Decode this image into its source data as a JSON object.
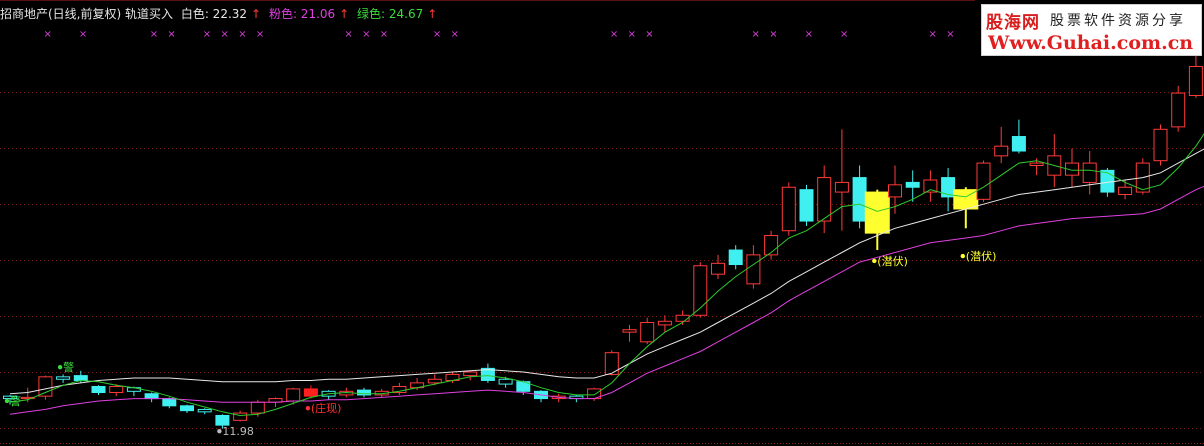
{
  "header": {
    "title": "招商地产(日线,前复权) 轨道买入",
    "white_label": "白色: 22.32",
    "pink_label": "粉色: 21.06",
    "green_label": "绿色: 24.67",
    "arrow": "↑"
  },
  "logo": {
    "line1": "股海网",
    "line1b": "股票软件资源分享",
    "line2": "Www.Guhai.com.cn"
  },
  "colors": {
    "up": "#ff3a3a",
    "down": "#40f0f0",
    "white_line": "#e8e8e8",
    "pink_line": "#e040e0",
    "green_line": "#2ecc2e",
    "highlight": "#ffff30",
    "marker": "#e040e0",
    "grid": "#7a1a1a"
  },
  "chart_data": {
    "type": "candlestick",
    "price_range": [
      11.3,
      27.2
    ],
    "candles": [
      {
        "o": 12.95,
        "c": 12.85,
        "h": 13.0,
        "l": 12.6,
        "t": "h"
      },
      {
        "o": 12.85,
        "c": 12.9,
        "h": 13.3,
        "l": 12.7,
        "t": "h"
      },
      {
        "o": 12.95,
        "c": 13.75,
        "h": 13.8,
        "l": 12.8,
        "t": "u"
      },
      {
        "o": 13.75,
        "c": 13.65,
        "h": 13.85,
        "l": 13.5,
        "t": "h"
      },
      {
        "o": 13.8,
        "c": 13.6,
        "h": 14.0,
        "l": 13.5,
        "t": "d"
      },
      {
        "o": 13.35,
        "c": 13.1,
        "h": 13.4,
        "l": 13.0,
        "t": "d"
      },
      {
        "o": 13.1,
        "c": 13.35,
        "h": 13.45,
        "l": 12.95,
        "t": "u"
      },
      {
        "o": 13.3,
        "c": 13.15,
        "h": 13.35,
        "l": 12.95,
        "t": "h"
      },
      {
        "o": 13.05,
        "c": 12.85,
        "h": 13.1,
        "l": 12.7,
        "t": "d"
      },
      {
        "o": 12.85,
        "c": 12.55,
        "h": 12.9,
        "l": 12.45,
        "t": "d"
      },
      {
        "o": 12.55,
        "c": 12.35,
        "h": 12.6,
        "l": 12.25,
        "t": "d"
      },
      {
        "o": 12.4,
        "c": 12.3,
        "h": 12.45,
        "l": 12.2,
        "t": "h"
      },
      {
        "o": 12.15,
        "c": 11.75,
        "h": 12.2,
        "l": 11.6,
        "t": "d"
      },
      {
        "o": 11.95,
        "c": 12.25,
        "h": 12.35,
        "l": 11.9,
        "t": "u"
      },
      {
        "o": 12.25,
        "c": 12.7,
        "h": 12.8,
        "l": 12.1,
        "t": "u"
      },
      {
        "o": 12.7,
        "c": 12.85,
        "h": 12.9,
        "l": 12.5,
        "t": "h"
      },
      {
        "o": 12.75,
        "c": 13.25,
        "h": 13.3,
        "l": 12.6,
        "t": "u"
      },
      {
        "o": 12.95,
        "c": 13.25,
        "h": 13.4,
        "l": 12.85,
        "t": "s"
      },
      {
        "o": 13.15,
        "c": 12.95,
        "h": 13.2,
        "l": 12.8,
        "t": "h"
      },
      {
        "o": 13.0,
        "c": 13.15,
        "h": 13.3,
        "l": 12.9,
        "t": "h"
      },
      {
        "o": 13.2,
        "c": 13.0,
        "h": 13.3,
        "l": 12.9,
        "t": "d"
      },
      {
        "o": 13.0,
        "c": 13.15,
        "h": 13.25,
        "l": 12.9,
        "t": "h"
      },
      {
        "o": 13.1,
        "c": 13.35,
        "h": 13.5,
        "l": 13.0,
        "t": "u"
      },
      {
        "o": 13.3,
        "c": 13.5,
        "h": 13.7,
        "l": 13.2,
        "t": "u"
      },
      {
        "o": 13.5,
        "c": 13.65,
        "h": 13.85,
        "l": 13.4,
        "t": "h"
      },
      {
        "o": 13.6,
        "c": 13.85,
        "h": 13.95,
        "l": 13.5,
        "t": "u"
      },
      {
        "o": 13.8,
        "c": 13.95,
        "h": 14.0,
        "l": 13.6,
        "t": "h"
      },
      {
        "o": 14.1,
        "c": 13.6,
        "h": 14.3,
        "l": 13.5,
        "t": "d"
      },
      {
        "o": 13.65,
        "c": 13.45,
        "h": 13.75,
        "l": 13.3,
        "t": "h"
      },
      {
        "o": 13.55,
        "c": 13.15,
        "h": 13.6,
        "l": 13.0,
        "t": "d"
      },
      {
        "o": 13.15,
        "c": 12.85,
        "h": 13.2,
        "l": 12.7,
        "t": "d"
      },
      {
        "o": 12.85,
        "c": 12.95,
        "h": 13.05,
        "l": 12.7,
        "t": "h"
      },
      {
        "o": 12.95,
        "c": 12.85,
        "h": 13.0,
        "l": 12.7,
        "t": "h"
      },
      {
        "o": 12.85,
        "c": 13.25,
        "h": 13.3,
        "l": 12.75,
        "t": "u"
      },
      {
        "o": 13.85,
        "c": 14.75,
        "h": 14.85,
        "l": 13.8,
        "t": "u"
      },
      {
        "o": 15.6,
        "c": 15.7,
        "h": 15.9,
        "l": 15.2,
        "t": "h"
      },
      {
        "o": 15.2,
        "c": 16.0,
        "h": 16.2,
        "l": 15.1,
        "t": "u"
      },
      {
        "o": 15.9,
        "c": 16.05,
        "h": 16.3,
        "l": 15.6,
        "t": "h"
      },
      {
        "o": 16.05,
        "c": 16.3,
        "h": 16.5,
        "l": 15.9,
        "t": "u"
      },
      {
        "o": 16.3,
        "c": 18.35,
        "h": 18.5,
        "l": 16.2,
        "t": "u"
      },
      {
        "o": 18.0,
        "c": 18.45,
        "h": 18.8,
        "l": 17.8,
        "t": "u"
      },
      {
        "o": 19.0,
        "c": 18.4,
        "h": 19.2,
        "l": 18.2,
        "t": "d"
      },
      {
        "o": 17.6,
        "c": 18.8,
        "h": 19.2,
        "l": 17.4,
        "t": "u"
      },
      {
        "o": 18.8,
        "c": 19.6,
        "h": 19.8,
        "l": 18.6,
        "t": "u"
      },
      {
        "o": 19.8,
        "c": 21.6,
        "h": 21.8,
        "l": 19.6,
        "t": "u"
      },
      {
        "o": 21.5,
        "c": 20.2,
        "h": 21.7,
        "l": 20.0,
        "t": "d"
      },
      {
        "o": 20.2,
        "c": 22.0,
        "h": 22.5,
        "l": 19.7,
        "t": "u"
      },
      {
        "o": 21.8,
        "c": 21.4,
        "h": 24.0,
        "l": 19.8,
        "t": "u"
      },
      {
        "o": 22.0,
        "c": 20.2,
        "h": 22.5,
        "l": 19.9,
        "t": "d"
      },
      {
        "o": 21.4,
        "c": 19.7,
        "h": 21.5,
        "l": 19.0,
        "t": "y"
      },
      {
        "o": 21.2,
        "c": 21.7,
        "h": 22.5,
        "l": 20.5,
        "t": "u"
      },
      {
        "o": 21.6,
        "c": 21.8,
        "h": 22.3,
        "l": 21.0,
        "t": "d"
      },
      {
        "o": 21.4,
        "c": 21.9,
        "h": 22.3,
        "l": 21.0,
        "t": "u"
      },
      {
        "o": 21.2,
        "c": 22.0,
        "h": 22.4,
        "l": 20.6,
        "t": "d"
      },
      {
        "o": 21.5,
        "c": 20.7,
        "h": 21.6,
        "l": 19.9,
        "t": "y"
      },
      {
        "o": 21.1,
        "c": 22.6,
        "h": 22.7,
        "l": 21.0,
        "t": "u"
      },
      {
        "o": 22.9,
        "c": 23.3,
        "h": 24.1,
        "l": 22.6,
        "t": "u"
      },
      {
        "o": 23.7,
        "c": 23.1,
        "h": 24.4,
        "l": 23.0,
        "t": "d"
      },
      {
        "o": 22.5,
        "c": 22.6,
        "h": 22.8,
        "l": 22.1,
        "t": "h"
      },
      {
        "o": 22.1,
        "c": 22.9,
        "h": 23.8,
        "l": 21.6,
        "t": "u"
      },
      {
        "o": 22.1,
        "c": 22.6,
        "h": 23.2,
        "l": 21.6,
        "t": "u"
      },
      {
        "o": 21.8,
        "c": 22.6,
        "h": 23.1,
        "l": 21.3,
        "t": "u"
      },
      {
        "o": 22.3,
        "c": 21.4,
        "h": 22.4,
        "l": 21.2,
        "t": "d"
      },
      {
        "o": 21.3,
        "c": 21.6,
        "h": 21.9,
        "l": 21.1,
        "t": "u"
      },
      {
        "o": 21.4,
        "c": 22.6,
        "h": 22.8,
        "l": 21.3,
        "t": "u"
      },
      {
        "o": 22.7,
        "c": 24.0,
        "h": 24.2,
        "l": 22.5,
        "t": "u"
      },
      {
        "o": 24.1,
        "c": 25.5,
        "h": 25.8,
        "l": 23.9,
        "t": "u"
      },
      {
        "o": 25.4,
        "c": 26.6,
        "h": 27.5,
        "l": 25.3,
        "t": "u"
      },
      {
        "o": 26.0,
        "c": 25.4,
        "h": 27.6,
        "l": 25.2,
        "t": "u"
      }
    ],
    "white_line": [
      13.05,
      13.1,
      13.25,
      13.4,
      13.5,
      13.6,
      13.65,
      13.7,
      13.7,
      13.7,
      13.65,
      13.6,
      13.55,
      13.55,
      13.55,
      13.55,
      13.6,
      13.6,
      13.65,
      13.65,
      13.7,
      13.75,
      13.8,
      13.85,
      13.9,
      13.95,
      14.0,
      14.05,
      14.0,
      13.95,
      13.85,
      13.75,
      13.7,
      13.7,
      13.9,
      14.3,
      14.7,
      15.0,
      15.3,
      15.6,
      16.0,
      16.4,
      16.8,
      17.2,
      17.7,
      18.1,
      18.5,
      18.9,
      19.3,
      19.6,
      19.9,
      20.1,
      20.3,
      20.5,
      20.7,
      20.9,
      21.1,
      21.3,
      21.4,
      21.5,
      21.6,
      21.7,
      21.8,
      21.9,
      22.0,
      22.2,
      22.6,
      23.0,
      23.4
    ],
    "pink_line": [
      12.2,
      12.3,
      12.4,
      12.55,
      12.65,
      12.75,
      12.8,
      12.85,
      12.85,
      12.85,
      12.8,
      12.75,
      12.7,
      12.7,
      12.7,
      12.7,
      12.75,
      12.75,
      12.8,
      12.8,
      12.85,
      12.9,
      12.95,
      13.0,
      13.05,
      13.1,
      13.15,
      13.2,
      13.15,
      13.1,
      13.0,
      12.9,
      12.85,
      12.85,
      13.1,
      13.5,
      13.9,
      14.2,
      14.5,
      14.8,
      15.2,
      15.6,
      16.0,
      16.4,
      16.9,
      17.3,
      17.7,
      18.1,
      18.5,
      18.7,
      18.9,
      19.1,
      19.3,
      19.4,
      19.5,
      19.6,
      19.8,
      20.0,
      20.1,
      20.2,
      20.3,
      20.35,
      20.4,
      20.45,
      20.5,
      20.7,
      21.1,
      21.5,
      21.8
    ],
    "green_line": [
      12.7,
      12.8,
      13.1,
      13.4,
      13.6,
      13.55,
      13.4,
      13.3,
      13.15,
      12.95,
      12.7,
      12.5,
      12.3,
      12.15,
      12.2,
      12.4,
      12.65,
      12.9,
      13.05,
      13.1,
      13.05,
      13.05,
      13.15,
      13.3,
      13.45,
      13.6,
      13.75,
      13.8,
      13.7,
      13.55,
      13.3,
      13.1,
      13.0,
      13.0,
      13.5,
      14.3,
      15.0,
      15.6,
      16.0,
      16.6,
      17.3,
      17.9,
      18.4,
      18.9,
      19.5,
      19.8,
      20.3,
      20.8,
      20.9,
      20.6,
      20.8,
      21.1,
      21.5,
      21.3,
      21.2,
      21.6,
      22.1,
      22.6,
      22.7,
      22.5,
      22.3,
      22.3,
      22.2,
      21.8,
      21.5,
      21.7,
      22.4,
      23.3,
      24.4
    ],
    "markers_top_index": [
      1,
      3,
      7,
      8,
      10,
      11,
      12,
      13,
      18,
      19,
      20,
      23,
      24,
      33,
      34,
      35,
      41,
      42,
      44,
      46,
      51,
      52,
      55,
      56,
      60,
      61,
      62,
      63,
      65
    ],
    "annotations": [
      {
        "text": "警",
        "index": 0,
        "price": 12.75,
        "color": "#3cdc3c"
      },
      {
        "text": "警",
        "index": 3,
        "price": 14.15,
        "color": "#3cdc3c"
      },
      {
        "text": "11.98",
        "index": 12,
        "price": 11.5,
        "color": "#bbbbbb"
      },
      {
        "text": "(庄现)",
        "index": 17,
        "price": 12.45,
        "color": "#ff3030"
      },
      {
        "text": "(潜伏)",
        "index": 49,
        "price": 18.55,
        "color": "#ffff30"
      },
      {
        "text": "(潜伏)",
        "index": 54,
        "price": 18.75,
        "color": "#ffff30"
      }
    ]
  }
}
